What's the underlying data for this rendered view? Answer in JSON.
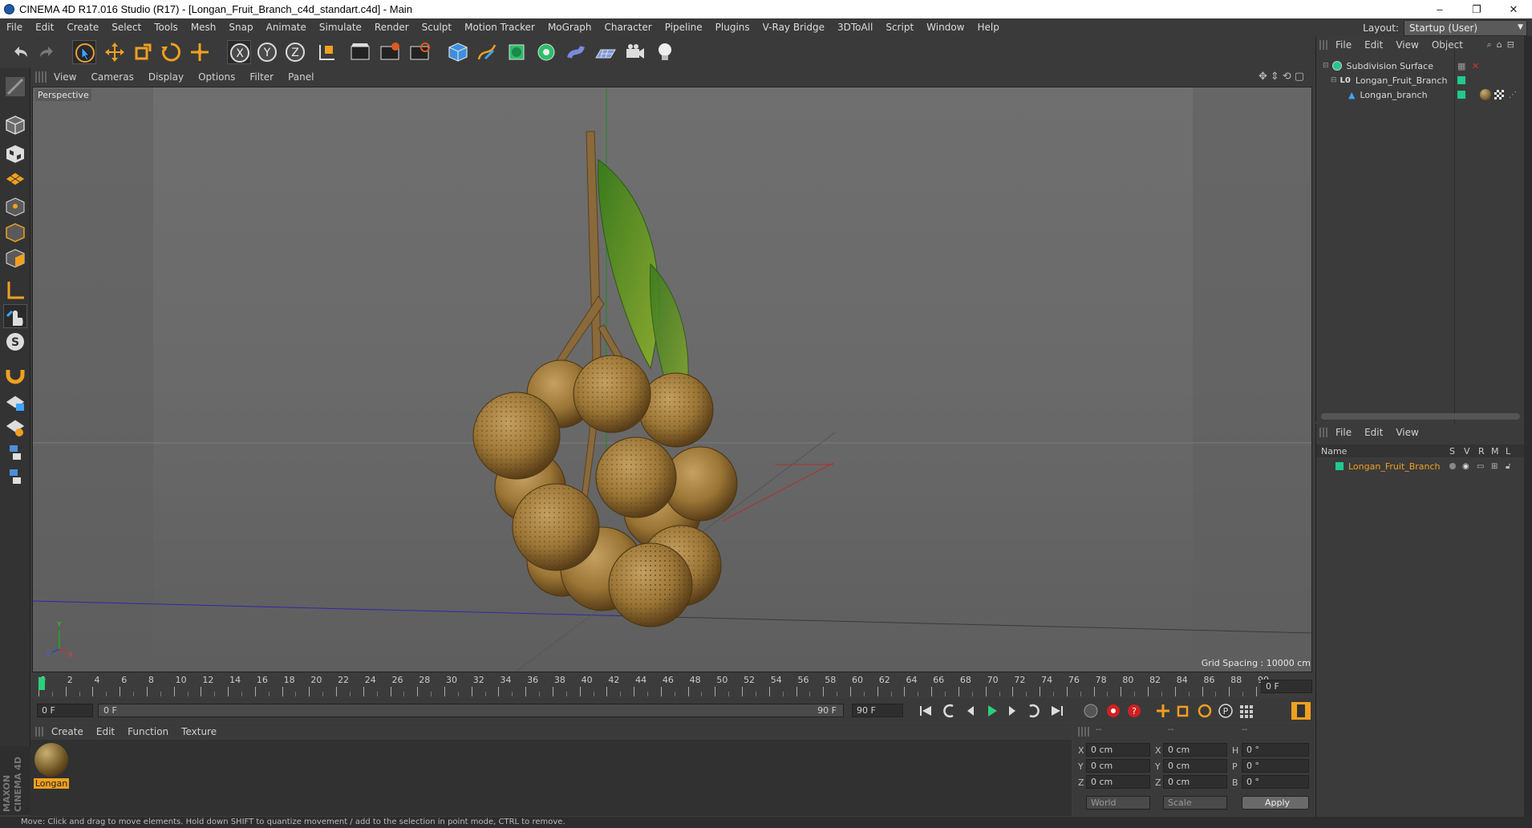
{
  "window": {
    "title": "CINEMA 4D R17.016 Studio (R17) - [Longan_Fruit_Branch_c4d_standart.c4d] - Main",
    "minimize": "–",
    "restore": "❐",
    "close": "✕"
  },
  "menubar": {
    "items": [
      "File",
      "Edit",
      "Create",
      "Select",
      "Tools",
      "Mesh",
      "Snap",
      "Animate",
      "Simulate",
      "Render",
      "Sculpt",
      "Motion Tracker",
      "MoGraph",
      "Character",
      "Pipeline",
      "Plugins",
      "V-Ray Bridge",
      "3DToAll",
      "Script",
      "Window",
      "Help"
    ],
    "layout_label": "Layout:",
    "layout_value": "Startup (User)"
  },
  "viewport": {
    "menu": [
      "View",
      "Cameras",
      "Display",
      "Options",
      "Filter",
      "Panel"
    ],
    "label": "Perspective",
    "grid_spacing": "Grid Spacing : 10000 cm",
    "axis_y": "Y",
    "axis_z": "Z",
    "axis_x": "X"
  },
  "timeline": {
    "ticks": [
      "0",
      "2",
      "4",
      "6",
      "8",
      "10",
      "12",
      "14",
      "16",
      "18",
      "20",
      "22",
      "24",
      "26",
      "28",
      "30",
      "32",
      "34",
      "36",
      "38",
      "40",
      "42",
      "44",
      "46",
      "48",
      "50",
      "52",
      "54",
      "56",
      "58",
      "60",
      "62",
      "64",
      "66",
      "68",
      "70",
      "72",
      "74",
      "76",
      "78",
      "80",
      "82",
      "84",
      "86",
      "88",
      "90"
    ],
    "current_frame": "0 F",
    "start_field": "0 F",
    "range_start": "0 F",
    "range_end": "90 F",
    "end_field": "90 F"
  },
  "materials": {
    "menu": [
      "Create",
      "Edit",
      "Function",
      "Texture"
    ],
    "items": [
      {
        "name": "Longan"
      }
    ]
  },
  "coords": {
    "headers": [
      "--",
      "--",
      "--"
    ],
    "rows": [
      {
        "a": "X",
        "av": "0 cm",
        "b": "X",
        "bv": "0 cm",
        "c": "H",
        "cv": "0 °"
      },
      {
        "a": "Y",
        "av": "0 cm",
        "b": "Y",
        "bv": "0 cm",
        "c": "P",
        "cv": "0 °"
      },
      {
        "a": "Z",
        "av": "0 cm",
        "b": "Z",
        "bv": "0 cm",
        "c": "B",
        "cv": "0 °"
      }
    ],
    "world": "World",
    "scale": "Scale",
    "apply": "Apply"
  },
  "object_manager": {
    "menu": [
      "File",
      "Edit",
      "View",
      "Object"
    ],
    "objects": [
      {
        "name": "Subdivision Surface"
      },
      {
        "name": "Longan_Fruit_Branch"
      },
      {
        "name": "Longan_branch"
      }
    ]
  },
  "attr_manager": {
    "menu": [
      "File",
      "Edit",
      "View"
    ],
    "columns": {
      "name": "Name",
      "s": "S",
      "v": "V",
      "r": "R",
      "m": "M",
      "l": "L"
    },
    "rows": [
      {
        "name": "Longan_Fruit_Branch"
      }
    ]
  },
  "status": "Move: Click and drag to move elements. Hold down SHIFT to quantize movement / add to the selection in point mode, CTRL to remove.",
  "maxon": "MAXON CINEMA 4D",
  "colors": {
    "accent": "#f0a020",
    "selection": "#3da4ff",
    "green_tag": "#22c88a"
  }
}
